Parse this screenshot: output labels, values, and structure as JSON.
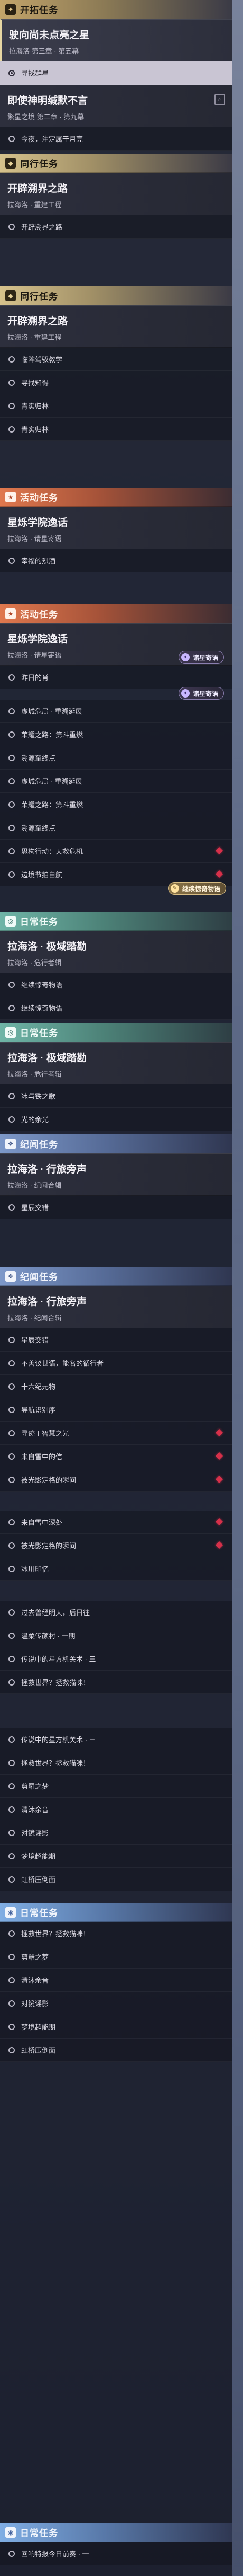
{
  "sections": {
    "trailblaze": "开拓任务",
    "companion": "同行任务",
    "event": "活动任务",
    "daily": "日常任务",
    "character": "纪闻任务",
    "routine": "日常任务"
  },
  "cards": {
    "c1": {
      "title": "驶向尚未点亮之星",
      "sub": "拉海洛 第三章 · 第五幕"
    },
    "c2": {
      "title": "即使神明缄默不言",
      "sub": "繁星之境 第二章 · 第九幕"
    },
    "c3": {
      "title": "开辟溯界之路",
      "sub": "拉海洛 · 重建工程"
    },
    "c4": {
      "title": "开辟溯界之路",
      "sub": "拉海洛 · 重建工程"
    },
    "c5": {
      "title": "星烁学院逸话",
      "sub": "拉海洛 · 请星寄语"
    },
    "c6": {
      "title": "星烁学院逸话",
      "sub": "拉海洛 · 请星寄语"
    },
    "c7": {
      "title": "拉海洛 · 极域踏勘",
      "sub": "拉海洛 · 危行者辑"
    },
    "c8": {
      "title": "拉海洛 · 极域踏勘",
      "sub": "拉海洛 · 危行者辑"
    },
    "c9": {
      "title": "拉海洛 · 行旅旁声",
      "sub": "拉海洛 · 纪闻合辑"
    },
    "c10": {
      "title": "拉海洛 · 行旅旁声",
      "sub": "拉海洛 · 纪闻合辑"
    }
  },
  "items": {
    "i1": "寻找群星",
    "i2": "今夜，注定属于月亮",
    "i3": "开辟溯界之路",
    "i4": "临阵驾驭教学",
    "i5": "寻找知得",
    "i6": "青实归林",
    "i7": "青实归林",
    "i8": "幸福的烈酒",
    "i9": "昨日的肖",
    "i10": "虚城危局 · 重溯延展",
    "i11": "荣耀之路：第斗重燃",
    "i12": "溯源至终点",
    "i13": "虚城危局 · 重溯延展",
    "i14": "荣耀之路：第斗重燃",
    "i15": "溯源至终点",
    "i16": "思构行动：天救危机",
    "i17": "边境节拍自航",
    "i18": "继续惊奇物语",
    "i19": "继续惊奇物语",
    "i20": "冰与铁之歌",
    "i21": "光的余光",
    "i22": "星辰交错",
    "i23": "星辰交错",
    "i24": "不善议世语，能名的循行者",
    "i25": "十六纪元物",
    "i26": "导航识别序",
    "i27": "寻迹于智慧之光",
    "i28": "来自雪中的信",
    "i29": "被光影定格的瞬间",
    "i30": "来自雪中深处",
    "i31": "被光影定格的瞬间",
    "i32": "冰川印忆",
    "i33": "过去曾经明天，后日往",
    "i34": "温柔传颜村 · 一期",
    "i35": "传说中的星方机关术 · 三",
    "i36": "拯救世界？拯救猫咪！",
    "i37": "传说中的星方机关术 · 三",
    "i38": "拯救世界？拯救猫咪！",
    "i39": "剪羅之梦",
    "i40": "清沐余音",
    "i41": "对镜谣影",
    "i42": "梦境超能期",
    "i43": "虹桥压倒面",
    "i44": "拯救世界？拯救猫咪！",
    "i45": "剪羅之梦",
    "i46": "清沐余音",
    "i47": "对镜谣影",
    "i48": "梦境超能期",
    "i49": "虹桥压倒面",
    "i50": "回响特报今日前奏 · 一"
  },
  "tags": {
    "t1": "诸星寄语",
    "t2": "诸星寄语",
    "t3": "继续惊奇物语"
  },
  "colors": {
    "trailblaze": "#c3a46a",
    "companion": "#d6c28c",
    "event": "#e0784e",
    "daily": "#6fb5a7",
    "character": "#7d98c9",
    "routine": "#80aee4",
    "marker": "#d6304a"
  }
}
